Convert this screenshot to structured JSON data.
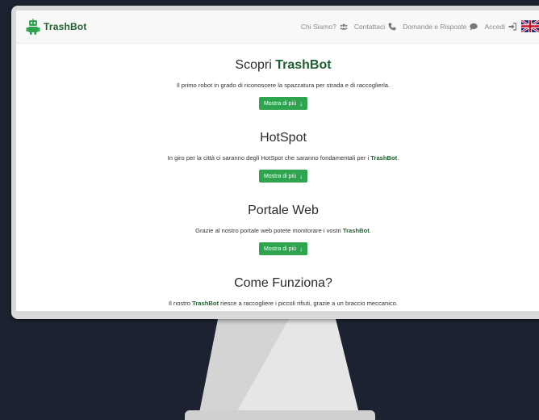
{
  "brand": {
    "name": "TrashBot"
  },
  "nav": {
    "items": [
      {
        "label": "Chi Siamo?",
        "icon": "users-icon"
      },
      {
        "label": "Contattaci",
        "icon": "phone-icon"
      },
      {
        "label": "Domande e Risposte",
        "icon": "comment-icon"
      },
      {
        "label": "Accedi",
        "icon": "sign-in-icon"
      }
    ],
    "language_flag": "uk-flag-icon"
  },
  "sections": [
    {
      "title_prefix": "Scopri ",
      "title_highlight": "TrashBot",
      "description": "Il primo robot in grado di riconoscere la spazzatura per strada e di raccoglierla.",
      "button_label": "Mostra di più"
    },
    {
      "title": "HotSpot",
      "description_prefix": "In giro per la città ci saranno degli HotSpot che saranno fondamentali per i ",
      "description_bold": "TrashBot",
      "description_suffix": ".",
      "button_label": "Mostra di più"
    },
    {
      "title": "Portale Web",
      "description_prefix": "Grazie al nostro portale web potete monitorare i vostri ",
      "description_bold": "TrashBot",
      "description_suffix": ".",
      "button_label": "Mostra di più"
    },
    {
      "title": "Come Funziona?",
      "description_prefix": "Il nostro ",
      "description_bold": "TrashBot",
      "description_suffix": " riesce a raccogliere i piccoli rifiuti, grazie a un braccio meccanico."
    }
  ],
  "colors": {
    "brand_green": "#1f5f2e",
    "button_green": "#2ea44f",
    "background": "#1c2230",
    "monitor": "#d9d9d9"
  }
}
